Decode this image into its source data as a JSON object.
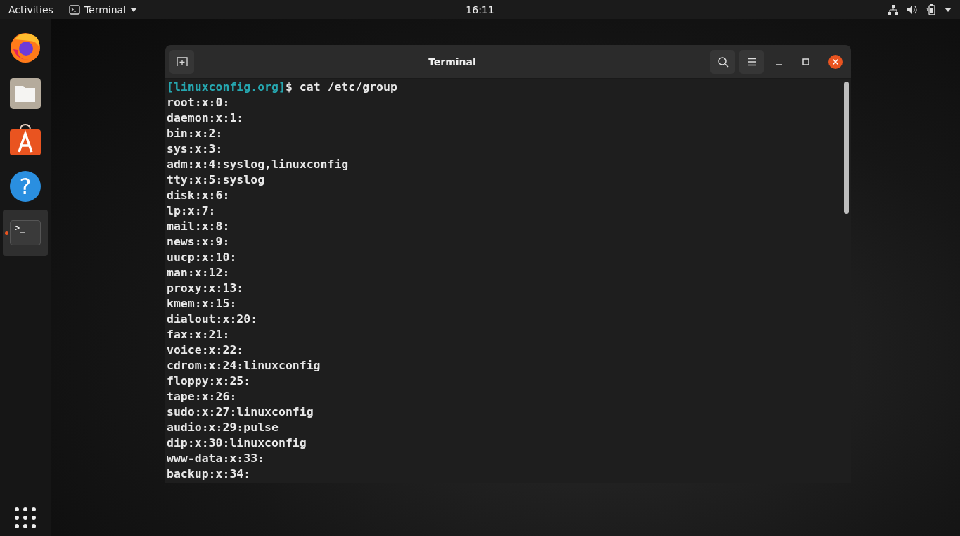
{
  "top_bar": {
    "activities": "Activities",
    "app_menu": "Terminal",
    "clock": "16:11"
  },
  "dock": {
    "items": [
      {
        "kind": "browser",
        "running": false,
        "selected": false
      },
      {
        "kind": "files",
        "running": false,
        "selected": false
      },
      {
        "kind": "software",
        "running": false,
        "selected": false
      },
      {
        "kind": "help",
        "running": false,
        "selected": false,
        "glyph": "?"
      },
      {
        "kind": "terminal",
        "running": true,
        "selected": true,
        "glyph": ">_"
      }
    ]
  },
  "window": {
    "title": "Terminal",
    "prompt": {
      "host": "[linuxconfig.org]",
      "command": "$ cat /etc/group"
    },
    "lines": [
      "root:x:0:",
      "daemon:x:1:",
      "bin:x:2:",
      "sys:x:3:",
      "adm:x:4:syslog,linuxconfig",
      "tty:x:5:syslog",
      "disk:x:6:",
      "lp:x:7:",
      "mail:x:8:",
      "news:x:9:",
      "uucp:x:10:",
      "man:x:12:",
      "proxy:x:13:",
      "kmem:x:15:",
      "dialout:x:20:",
      "fax:x:21:",
      "voice:x:22:",
      "cdrom:x:24:linuxconfig",
      "floppy:x:25:",
      "tape:x:26:",
      "sudo:x:27:linuxconfig",
      "audio:x:29:pulse",
      "dip:x:30:linuxconfig",
      "www-data:x:33:",
      "backup:x:34:"
    ]
  }
}
